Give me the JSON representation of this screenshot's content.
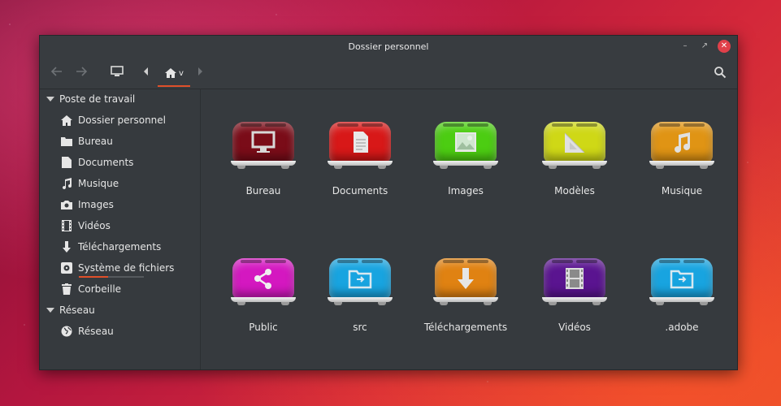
{
  "window": {
    "title": "Dossier personnel"
  },
  "toolbar": {
    "home_dropdown": "v"
  },
  "sidebar": {
    "section1": "Poste de travail",
    "items": [
      {
        "label": "Dossier personnel",
        "icon": "home-icon"
      },
      {
        "label": "Bureau",
        "icon": "folder-icon"
      },
      {
        "label": "Documents",
        "icon": "document-icon"
      },
      {
        "label": "Musique",
        "icon": "music-icon"
      },
      {
        "label": "Images",
        "icon": "camera-icon"
      },
      {
        "label": "Vidéos",
        "icon": "film-icon"
      },
      {
        "label": "Téléchargements",
        "icon": "download-icon"
      },
      {
        "label": "Système de fichiers",
        "icon": "disk-icon",
        "usage": 0.45
      },
      {
        "label": "Corbeille",
        "icon": "trash-icon"
      }
    ],
    "section2": "Réseau",
    "network_items": [
      {
        "label": "Réseau",
        "icon": "globe-icon"
      }
    ]
  },
  "content": {
    "tiles": [
      {
        "label": "Bureau",
        "color": "#7a0c18",
        "icon": "monitor-icon"
      },
      {
        "label": "Documents",
        "color": "#d81818",
        "icon": "document-icon"
      },
      {
        "label": "Images",
        "color": "#4ccd12",
        "icon": "image-icon"
      },
      {
        "label": "Modèles",
        "color": "#cfd816",
        "icon": "template-icon"
      },
      {
        "label": "Musique",
        "color": "#e09414",
        "icon": "music-icon"
      },
      {
        "label": "Public",
        "color": "#d418c0",
        "icon": "share-icon"
      },
      {
        "label": "src",
        "color": "#18a4e0",
        "icon": "folder-icon"
      },
      {
        "label": "Téléchargements",
        "color": "#e08212",
        "icon": "download-icon"
      },
      {
        "label": "Vidéos",
        "color": "#5a1490",
        "icon": "film-icon"
      },
      {
        "label": ".adobe",
        "color": "#18a4e0",
        "icon": "folder-icon"
      }
    ]
  }
}
